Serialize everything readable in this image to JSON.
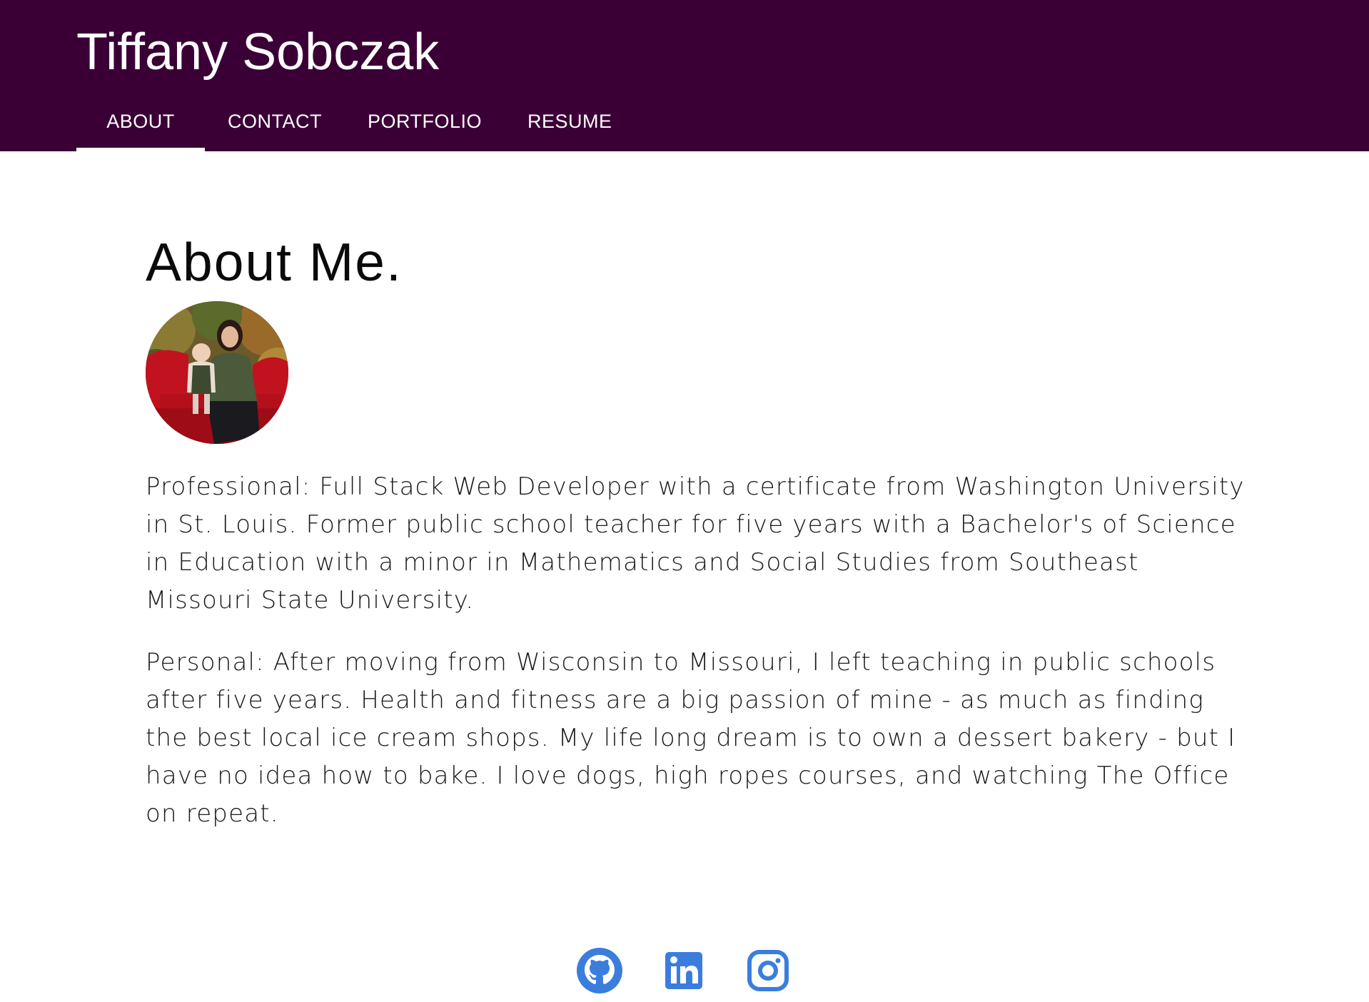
{
  "header": {
    "title": "Tiffany Sobczak",
    "nav": [
      {
        "label": "ABOUT",
        "active": true
      },
      {
        "label": "CONTACT",
        "active": false
      },
      {
        "label": "PORTFOLIO",
        "active": false
      },
      {
        "label": "RESUME",
        "active": false
      }
    ]
  },
  "about": {
    "heading": "About Me.",
    "professional": "Professional: Full Stack Web Developer with a certificate from Washington University in St. Louis. Former public school teacher for five years with a Bachelor's of Science in Education with a minor in Mathematics and Social Studies from Southeast Missouri State University.",
    "personal": "Personal: After moving from Wisconsin to Missouri, I left teaching in public schools after five years. Health and fitness are a big passion of mine - as much as finding the best local ice cream shops. My life long dream is to own a dessert bakery - but I have no idea how to bake. I love dogs, high ropes courses, and watching The Office on repeat."
  },
  "social": {
    "icons": [
      "github-icon",
      "linkedin-icon",
      "instagram-icon"
    ],
    "icon_color": "#3b7ddd"
  },
  "colors": {
    "header_bg": "#3a0036",
    "header_text": "#ffffff",
    "body_text": "#1a1a1a"
  }
}
